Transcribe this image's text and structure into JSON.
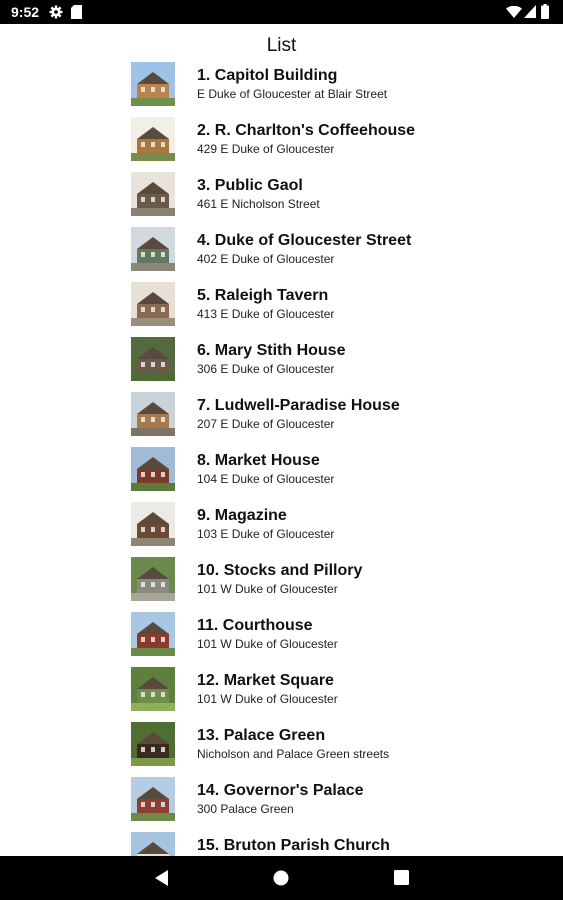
{
  "status_bar": {
    "time": "9:52"
  },
  "header": {
    "title": "List"
  },
  "items": [
    {
      "title": "1. Capitol Building",
      "address": "E Duke of Gloucester at Blair Street",
      "sky": "#9ec3e6",
      "wall": "#b9824f",
      "ground": "#6f8f4a"
    },
    {
      "title": "2. R. Charlton's Coffeehouse",
      "address": "429 E Duke of Gloucester",
      "sky": "#f2efe6",
      "wall": "#a9783f",
      "ground": "#7a8a4a"
    },
    {
      "title": "3. Public Gaol",
      "address": "461 E Nicholson Street",
      "sky": "#e8e4dc",
      "wall": "#6b5a48",
      "ground": "#8a8270"
    },
    {
      "title": "4. Duke of Gloucester Street",
      "address": "402 E Duke of Gloucester",
      "sky": "#cfd9de",
      "wall": "#5e7a5a",
      "ground": "#8c8778"
    },
    {
      "title": "5. Raleigh Tavern",
      "address": "413 E Duke of Gloucester",
      "sky": "#e6e0d6",
      "wall": "#8a6a4f",
      "ground": "#9a8f7a"
    },
    {
      "title": "6. Mary Stith House",
      "address": "306 E Duke of Gloucester",
      "sky": "#556b3e",
      "wall": "#6a5a4a",
      "ground": "#4e6b34"
    },
    {
      "title": "7. Ludwell-Paradise House",
      "address": "207 E Duke of Gloucester",
      "sky": "#c9d3d8",
      "wall": "#a77a4c",
      "ground": "#7d7466"
    },
    {
      "title": "8. Market House",
      "address": "104 E Duke of Gloucester",
      "sky": "#9fbbd6",
      "wall": "#7a3a2a",
      "ground": "#5d7a3a"
    },
    {
      "title": "9. Magazine",
      "address": "103 E Duke of Gloucester",
      "sky": "#eceae4",
      "wall": "#6a4a34",
      "ground": "#8c8474"
    },
    {
      "title": "10. Stocks and Pillory",
      "address": "101 W Duke of Gloucester",
      "sky": "#6d8a4d",
      "wall": "#8a8a80",
      "ground": "#a8a598"
    },
    {
      "title": "11. Courthouse",
      "address": "101 W Duke of Gloucester",
      "sky": "#a9c6e3",
      "wall": "#8a3b2c",
      "ground": "#6a8a4a"
    },
    {
      "title": "12. Market Square",
      "address": "101 W Duke of Gloucester",
      "sky": "#5f7f3e",
      "wall": "#6e8f4a",
      "ground": "#8fb05a"
    },
    {
      "title": "13. Palace Green",
      "address": "Nicholson and Palace Green streets",
      "sky": "#4f6f32",
      "wall": "#3a2a1e",
      "ground": "#7a9a4a"
    },
    {
      "title": "14. Governor's Palace",
      "address": "300 Palace Green",
      "sky": "#b5cde3",
      "wall": "#8c4030",
      "ground": "#6e8a4a"
    },
    {
      "title": "15. Bruton Parish Church",
      "address": "",
      "sky": "#a7c4df",
      "wall": "#e8e2d4",
      "ground": "#7a9050"
    }
  ]
}
